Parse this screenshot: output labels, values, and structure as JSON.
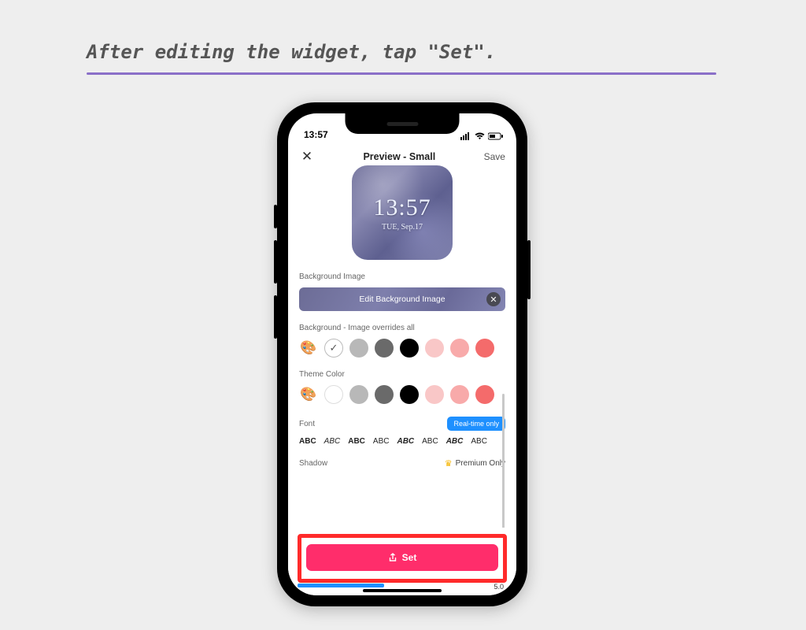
{
  "instruction": "After editing the widget, tap \"Set\".",
  "statusbar": {
    "time": "13:57"
  },
  "header": {
    "title": "Preview - Small",
    "save": "Save"
  },
  "widget": {
    "time": "13:57",
    "date": "TUE, Sep.17"
  },
  "sections": {
    "bg_image_label": "Background Image",
    "edit_bg_label": "Edit Background Image",
    "bg_override_label": "Background - Image overrides all",
    "theme_color_label": "Theme Color",
    "font_label": "Font",
    "realtime_badge": "Real-time only",
    "shadow_label": "Shadow",
    "premium_label": "Premium Only"
  },
  "bg_swatches": [
    "#fff",
    "#b8b8b8",
    "#6a6a6a",
    "#000",
    "#f9c7c7",
    "#f8aaaa",
    "#f46b6b"
  ],
  "theme_swatches": [
    "#fff",
    "#b8b8b8",
    "#6a6a6a",
    "#000",
    "#f9c7c7",
    "#f8aaaa",
    "#f46b6b"
  ],
  "fonts": [
    "ABC",
    "ABC",
    "ABC",
    "ABC",
    "ABC",
    "ABC",
    "ABC",
    "ABC"
  ],
  "set_button": "Set",
  "corner_num": "5.0"
}
